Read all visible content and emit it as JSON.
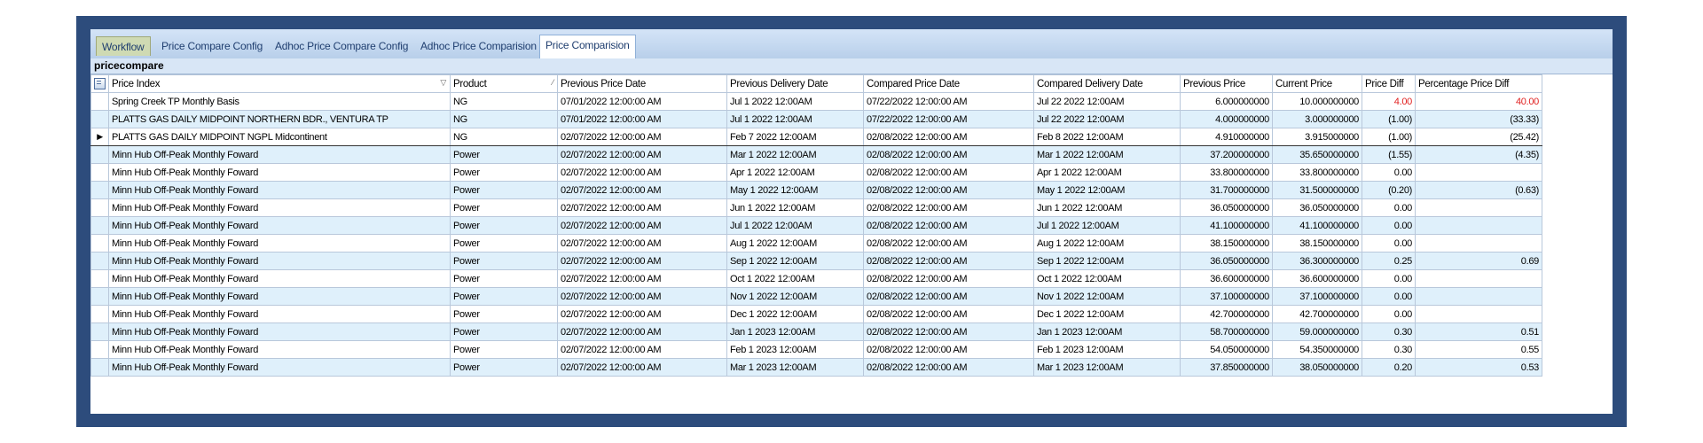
{
  "tabs": [
    "Workflow",
    "Price Compare Config",
    "Adhoc Price Compare Config",
    "Adhoc Price Comparision",
    "Price Comparision"
  ],
  "active_tab_index": 4,
  "grid": {
    "title": "pricecompare",
    "columns": [
      "Price Index",
      "Product",
      "Previous Price Date",
      "Previous Delivery Date",
      "Compared Price Date",
      "Compared Delivery Date",
      "Previous Price",
      "Current Price",
      "Price Diff",
      "Percentage Price Diff"
    ],
    "rows": [
      {
        "price_index": "Spring Creek TP Monthly Basis",
        "product": "NG",
        "prev_price_date": "07/01/2022 12:00:00 AM",
        "prev_delivery_date": "Jul  1 2022 12:00AM",
        "compared_price_date": "07/22/2022 12:00:00 AM",
        "compared_delivery_date": "Jul 22 2022 12:00AM",
        "previous_price": "6.000000000",
        "current_price": "10.000000000",
        "price_diff": "4.00",
        "pct_diff": "40.00",
        "highlight": true
      },
      {
        "price_index": "PLATTS GAS DAILY MIDPOINT NORTHERN BDR., VENTURA TP",
        "product": "NG",
        "prev_price_date": "07/01/2022 12:00:00 AM",
        "prev_delivery_date": "Jul  1 2022 12:00AM",
        "compared_price_date": "07/22/2022 12:00:00 AM",
        "compared_delivery_date": "Jul 22 2022 12:00AM",
        "previous_price": "4.000000000",
        "current_price": "3.000000000",
        "price_diff": "(1.00)",
        "pct_diff": "(33.33)",
        "highlight": false
      },
      {
        "price_index": "PLATTS GAS DAILY MIDPOINT NGPL Midcontinent",
        "product": "NG",
        "prev_price_date": "02/07/2022 12:00:00 AM",
        "prev_delivery_date": "Feb  7 2022 12:00AM",
        "compared_price_date": "02/08/2022 12:00:00 AM",
        "compared_delivery_date": "Feb  8 2022 12:00AM",
        "previous_price": "4.910000000",
        "current_price": "3.915000000",
        "price_diff": "(1.00)",
        "pct_diff": "(25.42)",
        "highlight": false,
        "selected": true
      },
      {
        "price_index": "Minn Hub Off-Peak Monthly Foward",
        "product": "Power",
        "prev_price_date": "02/07/2022 12:00:00 AM",
        "prev_delivery_date": "Mar  1 2022 12:00AM",
        "compared_price_date": "02/08/2022 12:00:00 AM",
        "compared_delivery_date": "Mar  1 2022 12:00AM",
        "previous_price": "37.200000000",
        "current_price": "35.650000000",
        "price_diff": "(1.55)",
        "pct_diff": "(4.35)",
        "highlight": false
      },
      {
        "price_index": "Minn Hub Off-Peak Monthly Foward",
        "product": "Power",
        "prev_price_date": "02/07/2022 12:00:00 AM",
        "prev_delivery_date": "Apr  1 2022 12:00AM",
        "compared_price_date": "02/08/2022 12:00:00 AM",
        "compared_delivery_date": "Apr  1 2022 12:00AM",
        "previous_price": "33.800000000",
        "current_price": "33.800000000",
        "price_diff": "0.00",
        "pct_diff": "",
        "highlight": false
      },
      {
        "price_index": "Minn Hub Off-Peak Monthly Foward",
        "product": "Power",
        "prev_price_date": "02/07/2022 12:00:00 AM",
        "prev_delivery_date": "May  1 2022 12:00AM",
        "compared_price_date": "02/08/2022 12:00:00 AM",
        "compared_delivery_date": "May  1 2022 12:00AM",
        "previous_price": "31.700000000",
        "current_price": "31.500000000",
        "price_diff": "(0.20)",
        "pct_diff": "(0.63)",
        "highlight": false
      },
      {
        "price_index": "Minn Hub Off-Peak Monthly Foward",
        "product": "Power",
        "prev_price_date": "02/07/2022 12:00:00 AM",
        "prev_delivery_date": "Jun  1 2022 12:00AM",
        "compared_price_date": "02/08/2022 12:00:00 AM",
        "compared_delivery_date": "Jun  1 2022 12:00AM",
        "previous_price": "36.050000000",
        "current_price": "36.050000000",
        "price_diff": "0.00",
        "pct_diff": "",
        "highlight": false
      },
      {
        "price_index": "Minn Hub Off-Peak Monthly Foward",
        "product": "Power",
        "prev_price_date": "02/07/2022 12:00:00 AM",
        "prev_delivery_date": "Jul  1 2022 12:00AM",
        "compared_price_date": "02/08/2022 12:00:00 AM",
        "compared_delivery_date": "Jul  1 2022 12:00AM",
        "previous_price": "41.100000000",
        "current_price": "41.100000000",
        "price_diff": "0.00",
        "pct_diff": "",
        "highlight": false
      },
      {
        "price_index": "Minn Hub Off-Peak Monthly Foward",
        "product": "Power",
        "prev_price_date": "02/07/2022 12:00:00 AM",
        "prev_delivery_date": "Aug  1 2022 12:00AM",
        "compared_price_date": "02/08/2022 12:00:00 AM",
        "compared_delivery_date": "Aug  1 2022 12:00AM",
        "previous_price": "38.150000000",
        "current_price": "38.150000000",
        "price_diff": "0.00",
        "pct_diff": "",
        "highlight": false
      },
      {
        "price_index": "Minn Hub Off-Peak Monthly Foward",
        "product": "Power",
        "prev_price_date": "02/07/2022 12:00:00 AM",
        "prev_delivery_date": "Sep  1 2022 12:00AM",
        "compared_price_date": "02/08/2022 12:00:00 AM",
        "compared_delivery_date": "Sep  1 2022 12:00AM",
        "previous_price": "36.050000000",
        "current_price": "36.300000000",
        "price_diff": "0.25",
        "pct_diff": "0.69",
        "highlight": false
      },
      {
        "price_index": "Minn Hub Off-Peak Monthly Foward",
        "product": "Power",
        "prev_price_date": "02/07/2022 12:00:00 AM",
        "prev_delivery_date": "Oct  1 2022 12:00AM",
        "compared_price_date": "02/08/2022 12:00:00 AM",
        "compared_delivery_date": "Oct  1 2022 12:00AM",
        "previous_price": "36.600000000",
        "current_price": "36.600000000",
        "price_diff": "0.00",
        "pct_diff": "",
        "highlight": false
      },
      {
        "price_index": "Minn Hub Off-Peak Monthly Foward",
        "product": "Power",
        "prev_price_date": "02/07/2022 12:00:00 AM",
        "prev_delivery_date": "Nov  1 2022 12:00AM",
        "compared_price_date": "02/08/2022 12:00:00 AM",
        "compared_delivery_date": "Nov  1 2022 12:00AM",
        "previous_price": "37.100000000",
        "current_price": "37.100000000",
        "price_diff": "0.00",
        "pct_diff": "",
        "highlight": false
      },
      {
        "price_index": "Minn Hub Off-Peak Monthly Foward",
        "product": "Power",
        "prev_price_date": "02/07/2022 12:00:00 AM",
        "prev_delivery_date": "Dec  1 2022 12:00AM",
        "compared_price_date": "02/08/2022 12:00:00 AM",
        "compared_delivery_date": "Dec  1 2022 12:00AM",
        "previous_price": "42.700000000",
        "current_price": "42.700000000",
        "price_diff": "0.00",
        "pct_diff": "",
        "highlight": false
      },
      {
        "price_index": "Minn Hub Off-Peak Monthly Foward",
        "product": "Power",
        "prev_price_date": "02/07/2022 12:00:00 AM",
        "prev_delivery_date": "Jan  1 2023 12:00AM",
        "compared_price_date": "02/08/2022 12:00:00 AM",
        "compared_delivery_date": "Jan  1 2023 12:00AM",
        "previous_price": "58.700000000",
        "current_price": "59.000000000",
        "price_diff": "0.30",
        "pct_diff": "0.51",
        "highlight": false
      },
      {
        "price_index": "Minn Hub Off-Peak Monthly Foward",
        "product": "Power",
        "prev_price_date": "02/07/2022 12:00:00 AM",
        "prev_delivery_date": "Feb  1 2023 12:00AM",
        "compared_price_date": "02/08/2022 12:00:00 AM",
        "compared_delivery_date": "Feb  1 2023 12:00AM",
        "previous_price": "54.050000000",
        "current_price": "54.350000000",
        "price_diff": "0.30",
        "pct_diff": "0.55",
        "highlight": false
      },
      {
        "price_index": "Minn Hub Off-Peak Monthly Foward",
        "product": "Power",
        "prev_price_date": "02/07/2022 12:00:00 AM",
        "prev_delivery_date": "Mar  1 2023 12:00AM",
        "compared_price_date": "02/08/2022 12:00:00 AM",
        "compared_delivery_date": "Mar  1 2023 12:00AM",
        "previous_price": "37.850000000",
        "current_price": "38.050000000",
        "price_diff": "0.20",
        "pct_diff": "0.53",
        "highlight": false
      }
    ]
  },
  "colors": {
    "frame": "#2d4c7c",
    "alt_row": "#dff0fb",
    "negative_highlight": "#e02020",
    "tab_text": "#1f3e6f"
  },
  "icons": {
    "selected_row": "row-pointer-icon",
    "column_chooser": "column-chooser-icon",
    "filter": "filter-icon",
    "sort": "sort-icon"
  }
}
